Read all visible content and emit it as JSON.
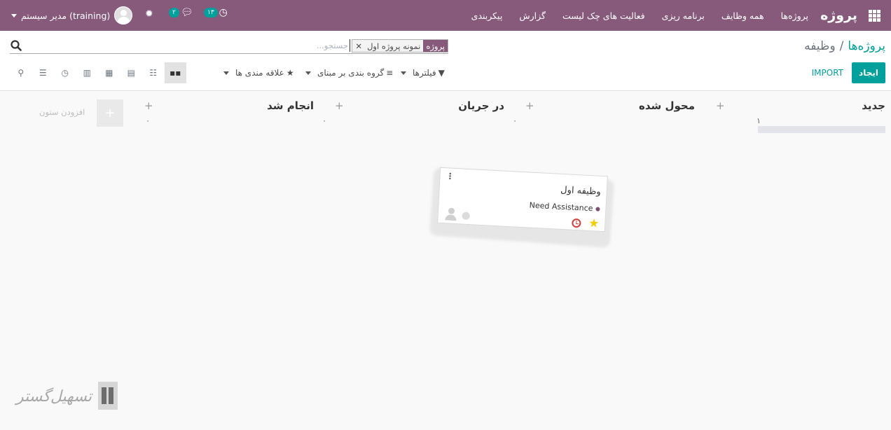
{
  "navbar": {
    "app_icon": "apps-grid-icon",
    "brand": "پروژه",
    "menu": [
      "پروژه‌ها",
      "همه وظایف",
      "برنامه ریزی",
      "فعالیت های چک لیست",
      "گزارش",
      "پیکربندی"
    ],
    "user_name": "مدیر سیستم (training)",
    "messages_badge": "۲",
    "activities_badge": "۱۳",
    "color": "#875a7b"
  },
  "breadcrumb": {
    "parent": "پروژه‌ها",
    "separator": "/",
    "current": "وظیفه"
  },
  "search": {
    "placeholder": "جستجو...",
    "facet_label": "پروژه",
    "facet_value": "نمونه پروژه اول"
  },
  "buttons": {
    "create": "ایجاد",
    "import": "IMPORT"
  },
  "filters": {
    "filters": "فیلترها",
    "group_by": "گروه بندی بر مبنای",
    "favorites": "علاقه مندی ها"
  },
  "views": [
    "kanban",
    "list",
    "calendar",
    "pivot",
    "graph",
    "activity",
    "gantt",
    "map"
  ],
  "kanban": {
    "columns": [
      {
        "title": "جدید",
        "count": "۱"
      },
      {
        "title": "محول شده",
        "count": "۰"
      },
      {
        "title": "در جریان",
        "count": "۰"
      },
      {
        "title": "انجام شد",
        "count": "۰"
      }
    ],
    "add_column_label": "افزودن ستون",
    "card": {
      "title": "وظیفه اول",
      "tag": "Need Assistance",
      "starred": true
    }
  },
  "watermark": {
    "text": "تسهیل‌گستر"
  },
  "colors": {
    "accent": "#00a09d",
    "brand": "#875a7b",
    "star": "#f3cc00",
    "overdue": "#d23f3a"
  }
}
